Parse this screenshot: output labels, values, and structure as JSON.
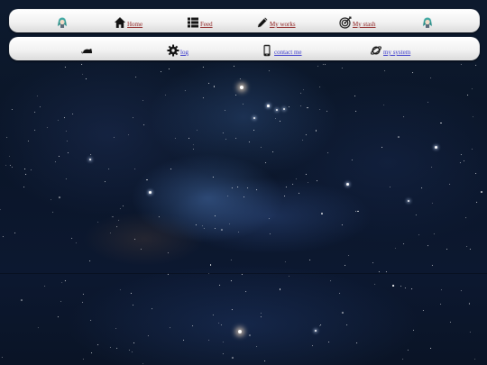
{
  "nav_primary": {
    "items": [
      {
        "label": "",
        "icon": "mascot-icon"
      },
      {
        "label": "Home",
        "icon": "home-icon"
      },
      {
        "label": "Feed",
        "icon": "list-icon"
      },
      {
        "label": "My works",
        "icon": "pencil-icon"
      },
      {
        "label": "My stash",
        "icon": "target-icon"
      },
      {
        "label": "",
        "icon": "mascot-icon"
      }
    ]
  },
  "nav_secondary": {
    "items": [
      {
        "label": "",
        "icon": "mouse-icon"
      },
      {
        "label": "log",
        "icon": "gear-icon"
      },
      {
        "label": "contact me",
        "icon": "phone-icon"
      },
      {
        "label": "my system",
        "icon": "planet-icon"
      }
    ]
  },
  "colors": {
    "primary_link": "#8b1a1a",
    "secondary_link": "#3a3acc",
    "bar_background": "#f2f2f2",
    "page_background": "#0b1424"
  }
}
